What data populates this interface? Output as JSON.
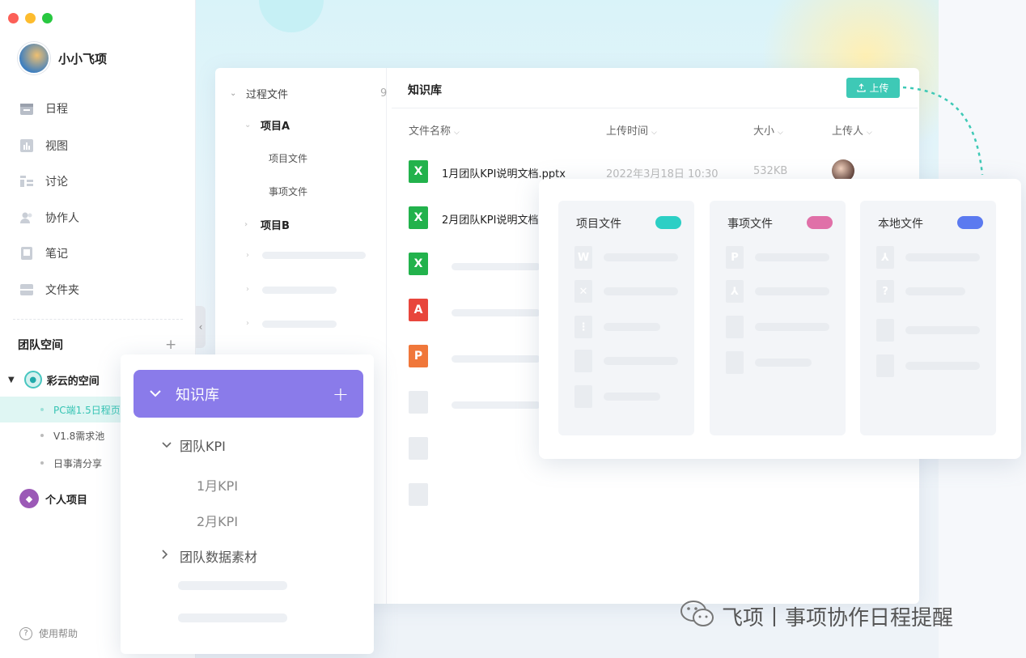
{
  "window_controls": {
    "colors": {
      "close": "#fc5f57",
      "minimize": "#fdbc2e",
      "maximize": "#28c840"
    }
  },
  "user": {
    "name": "小小飞项"
  },
  "nav": {
    "items": [
      {
        "label": "日程",
        "icon": "calendar-icon"
      },
      {
        "label": "视图",
        "icon": "chart-icon"
      },
      {
        "label": "讨论",
        "icon": "discussion-icon"
      },
      {
        "label": "协作人",
        "icon": "people-icon"
      },
      {
        "label": "笔记",
        "icon": "note-icon"
      },
      {
        "label": "文件夹",
        "icon": "folder-icon"
      }
    ]
  },
  "team": {
    "title": "团队空间",
    "add": "+",
    "space_name": "彩云的空间",
    "sub_items": [
      "PC端1.5日程页",
      "V1.8需求池",
      "日事清分享"
    ],
    "personal": "个人项目"
  },
  "help": {
    "label": "使用帮助",
    "icon": "?"
  },
  "tree": {
    "root": "过程文件",
    "root_count": "9",
    "project_a": "项目A",
    "a_children": [
      "项目文件",
      "事项文件"
    ],
    "project_b": "项目B"
  },
  "kb": {
    "title": "知识库",
    "upload": "上传",
    "columns": [
      "文件名称",
      "上传时间",
      "大小",
      "上传人"
    ],
    "files": [
      {
        "name": "1月团队KPI说明文档.pptx",
        "date": "2022年3月18日 10:30",
        "size": "532KB"
      },
      {
        "name": "2月团队KPI说明文档"
      }
    ],
    "file_icons": [
      "X",
      "X",
      "X",
      "A",
      "P"
    ]
  },
  "source_card": {
    "columns": [
      {
        "title": "项目文件",
        "color": "#2ccfc5"
      },
      {
        "title": "事项文件",
        "color": "#e070a8"
      },
      {
        "title": "本地文件",
        "color": "#5b7af0"
      }
    ]
  },
  "kb_panel": {
    "title": "知识库",
    "add": "+",
    "group1": "团队KPI",
    "children": [
      "1月KPI",
      "2月KPI"
    ],
    "group2": "团队数据素材"
  },
  "watermark": {
    "text": "飞项丨事项协作日程提醒"
  },
  "accent": {
    "teal": "#3ec9b6",
    "purple": "#8a7bea"
  }
}
